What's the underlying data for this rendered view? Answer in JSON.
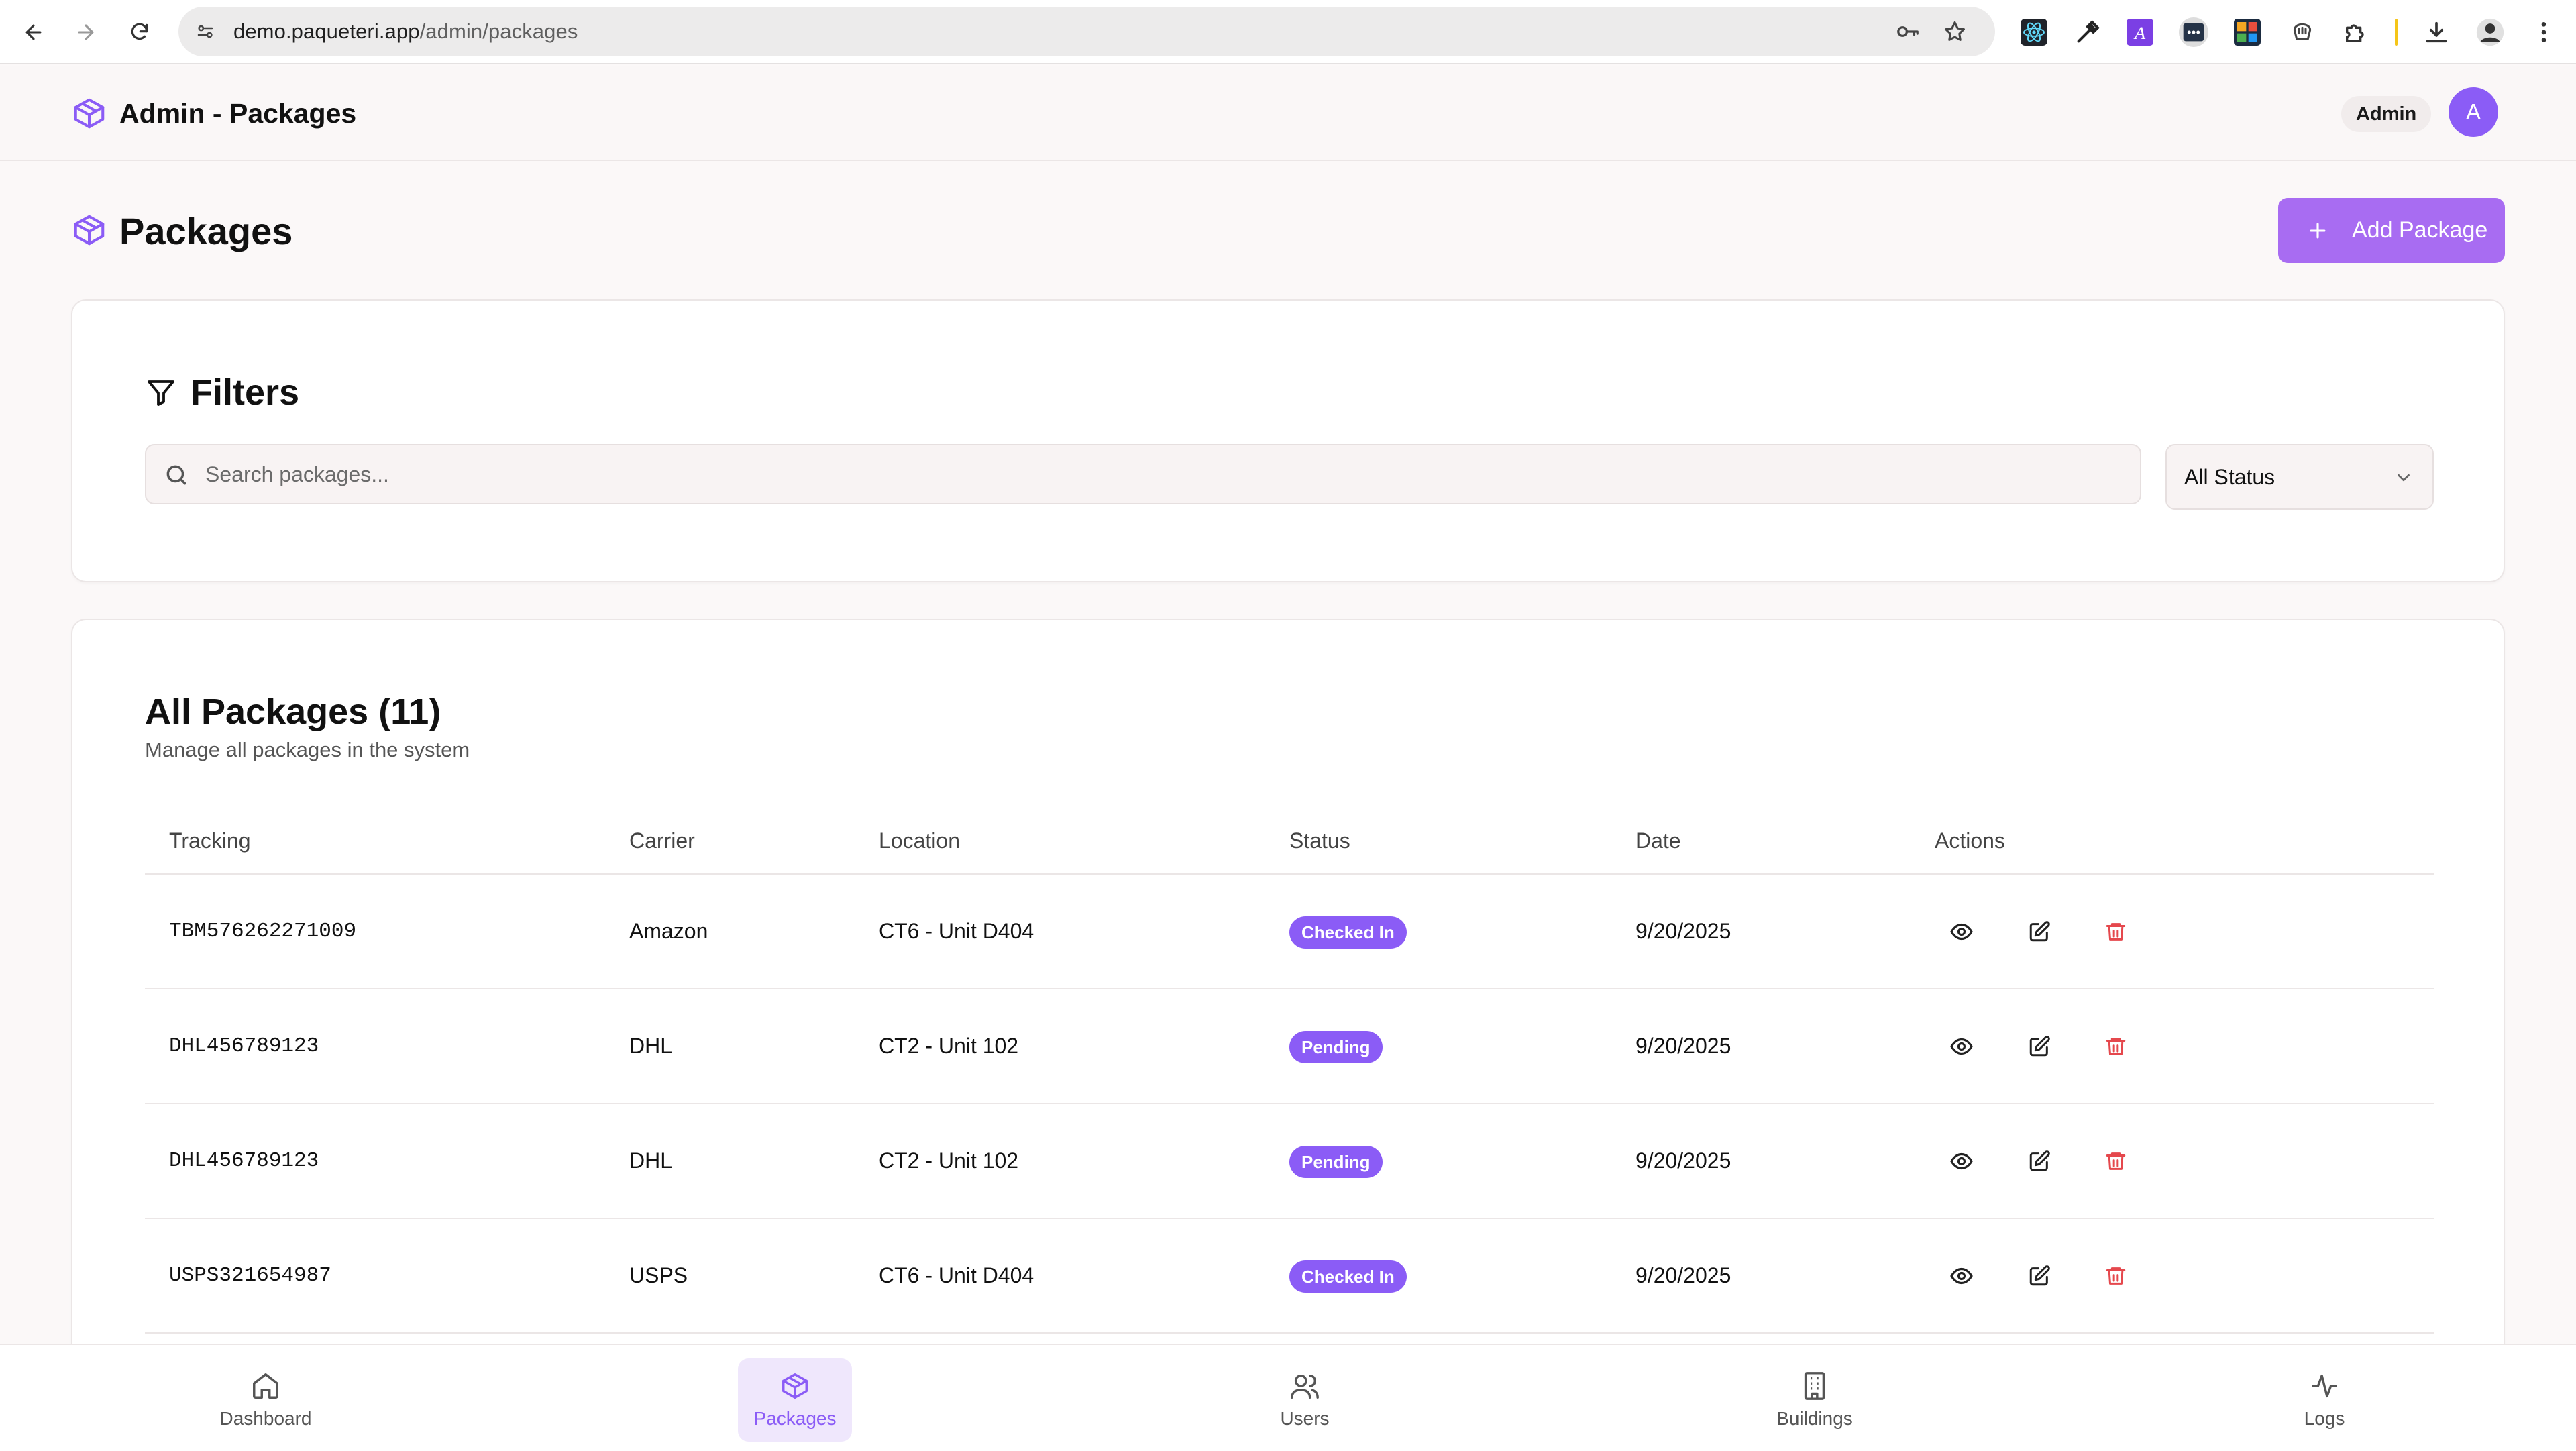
{
  "browser": {
    "url_host": "demo.paqueteri.app",
    "url_path": "/admin/packages"
  },
  "header": {
    "app_title": "Admin - Packages",
    "role_badge": "Admin",
    "avatar_initial": "A"
  },
  "page": {
    "title": "Packages",
    "add_button_label": "Add Package"
  },
  "filters": {
    "title": "Filters",
    "search_placeholder": "Search packages...",
    "search_value": "",
    "status_selected": "All Status"
  },
  "table": {
    "title": "All Packages (11)",
    "subtitle": "Manage all packages in the system",
    "columns": [
      "Tracking",
      "Carrier",
      "Location",
      "Status",
      "Date",
      "Actions"
    ],
    "rows": [
      {
        "tracking": "TBM576262271009",
        "carrier": "Amazon",
        "location": "CT6 - Unit D404",
        "status": "Checked In",
        "date": "9/20/2025"
      },
      {
        "tracking": "DHL456789123",
        "carrier": "DHL",
        "location": "CT2 - Unit 102",
        "status": "Pending",
        "date": "9/20/2025"
      },
      {
        "tracking": "DHL456789123",
        "carrier": "DHL",
        "location": "CT2 - Unit 102",
        "status": "Pending",
        "date": "9/20/2025"
      },
      {
        "tracking": "USPS321654987",
        "carrier": "USPS",
        "location": "CT6 - Unit D404",
        "status": "Checked In",
        "date": "9/20/2025"
      }
    ]
  },
  "bottom_nav": {
    "items": [
      {
        "label": "Dashboard",
        "icon": "home-icon",
        "active": false
      },
      {
        "label": "Packages",
        "icon": "package-icon",
        "active": true
      },
      {
        "label": "Users",
        "icon": "users-icon",
        "active": false
      },
      {
        "label": "Buildings",
        "icon": "building-icon",
        "active": false
      },
      {
        "label": "Logs",
        "icon": "activity-icon",
        "active": false
      }
    ]
  },
  "colors": {
    "accent": "#8b5cf6",
    "add_button": "#a86cf2",
    "delete": "#e5484d"
  }
}
